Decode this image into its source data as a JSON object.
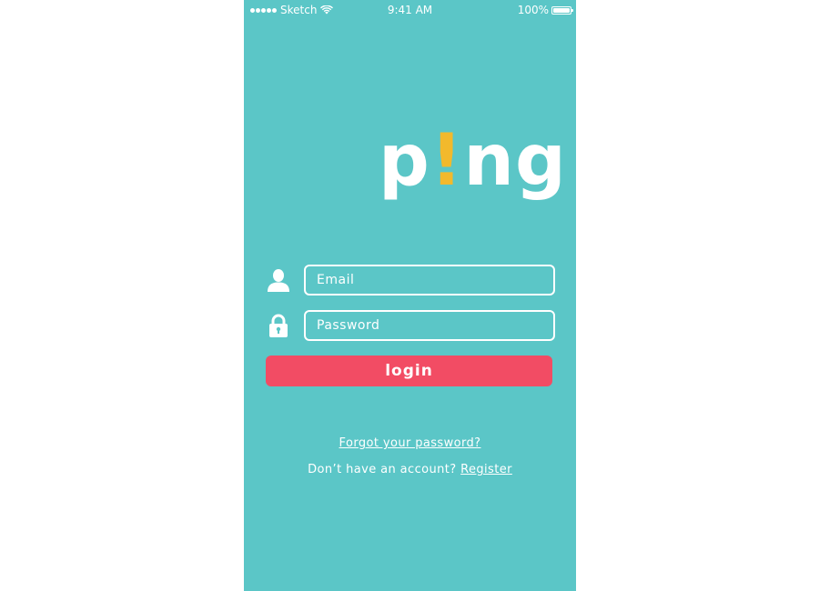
{
  "status_bar": {
    "carrier": "Sketch",
    "time": "9:41 AM",
    "battery_percent": "100%"
  },
  "logo": {
    "part1": "p",
    "bang": "!",
    "part2": "ng"
  },
  "colors": {
    "background": "#5bc6c7",
    "accent": "#f2b92c",
    "button": "#f24c64"
  },
  "form": {
    "email_placeholder": "Email",
    "email_value": "",
    "password_placeholder": "Password",
    "password_value": "",
    "login_label": "login"
  },
  "links": {
    "forgot_password": "Forgot your password?",
    "no_account_text": "Don’t have an account?",
    "register": "Register"
  },
  "icons": {
    "email_field": "user-icon",
    "password_field": "lock-icon",
    "wifi": "wifi-icon",
    "battery": "battery-icon"
  }
}
